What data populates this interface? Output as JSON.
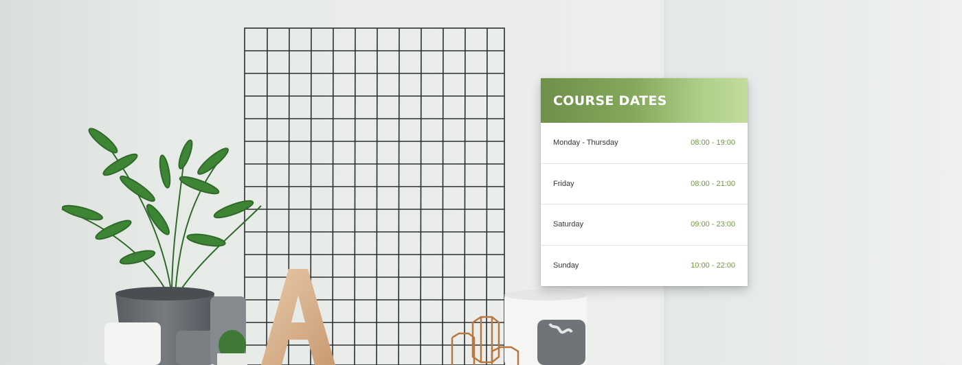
{
  "course": {
    "title": "COURSE DATES",
    "schedule": [
      {
        "day": "Monday - Thursday",
        "time": "08:00 - 19:00"
      },
      {
        "day": "Friday",
        "time": "08:00 - 21:00"
      },
      {
        "day": "Saturday",
        "time": "09:00 - 23:00"
      },
      {
        "day": "Sunday",
        "time": "10:00 - 22:00"
      }
    ]
  },
  "colors": {
    "accent": "#6f963f",
    "header_gradient_start": "#6f8f4a",
    "header_gradient_end": "#c3dc9e"
  }
}
